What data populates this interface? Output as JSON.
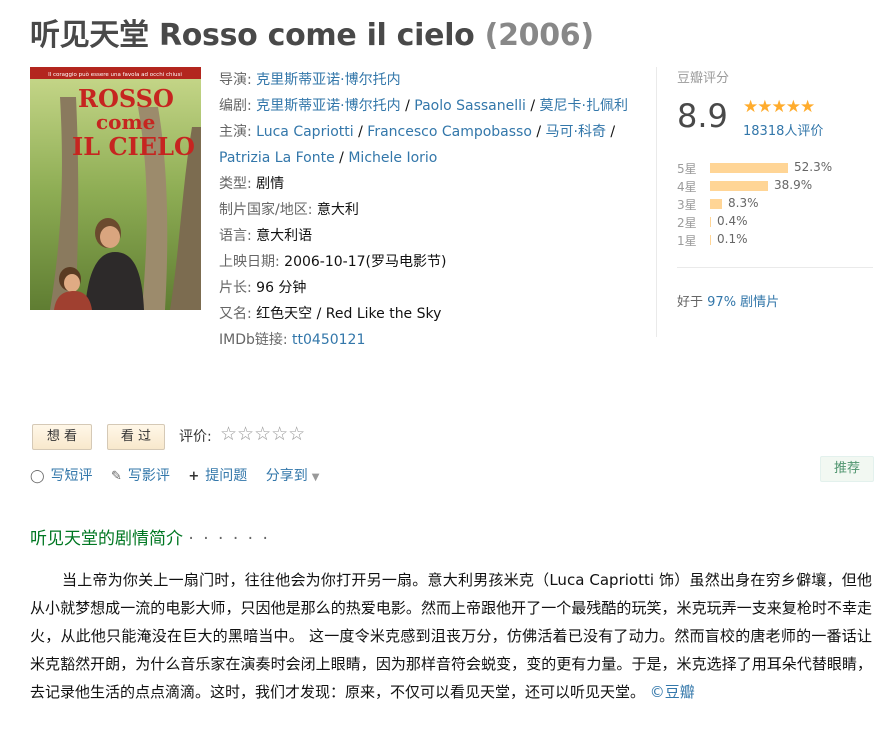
{
  "title": {
    "main": "听见天堂 Rosso come il cielo",
    "year": "(2006)"
  },
  "poster": {
    "tagline": "Il coraggio può essere una favola ad occhi chiusi",
    "title_line1": "ROSSO",
    "title_line2": "come",
    "title_line3": "IL CIELO"
  },
  "info": {
    "director_label": "导演:",
    "director": "克里斯蒂亚诺·博尔托内",
    "writer_label": "编剧:",
    "writers": [
      "克里斯蒂亚诺·博尔托内",
      "Paolo Sassanelli",
      "莫尼卡·扎佩利"
    ],
    "cast_label": "主演:",
    "cast": [
      "Luca Capriotti",
      "Francesco Campobasso",
      "马可·科奇",
      "Patrizia La Fonte",
      "Michele Iorio"
    ],
    "genre_label": "类型:",
    "genre": "剧情",
    "country_label": "制片国家/地区:",
    "country": "意大利",
    "language_label": "语言:",
    "language": "意大利语",
    "release_label": "上映日期:",
    "release": "2006-10-17(罗马电影节)",
    "runtime_label": "片长:",
    "runtime": "96 分钟",
    "aka_label": "又名:",
    "aka": "红色天空 / Red Like the Sky",
    "imdb_label": "IMDb链接:",
    "imdb": "tt0450121"
  },
  "rating": {
    "label": "豆瓣评分",
    "score": "8.9",
    "stars": "★★★★★",
    "votes": "18318人评价",
    "distribution": [
      {
        "label": "5星",
        "percent": 52.3,
        "text": "52.3%"
      },
      {
        "label": "4星",
        "percent": 38.9,
        "text": "38.9%"
      },
      {
        "label": "3星",
        "percent": 8.3,
        "text": "8.3%"
      },
      {
        "label": "2星",
        "percent": 0.4,
        "text": "0.4%"
      },
      {
        "label": "1星",
        "percent": 0.1,
        "text": "0.1%"
      }
    ],
    "better_prefix": "好于",
    "better_value": "97% 剧情片"
  },
  "actions": {
    "want": "想 看",
    "seen": "看 过",
    "rate_label": "评价:",
    "rate_stars": "☆☆☆☆☆",
    "short_review": "写短评",
    "review": "写影评",
    "question": "提问题",
    "share": "分享到",
    "recommend": "推荐"
  },
  "synopsis": {
    "heading": "听见天堂的剧情简介",
    "dots": "· · · · · ·",
    "text": "当上帝为你关上一扇门时，往往他会为你打开另一扇。意大利男孩米克（Luca Capriotti 饰）虽然出身在穷乡僻壤，但他从小就梦想成一流的电影大师，只因他是那么的热爱电影。然而上帝跟他开了一个最残酷的玩笑，米克玩弄一支来复枪时不幸走火，从此他只能淹没在巨大的黑暗当中。 这一度令米克感到沮丧万分，仿佛活着已没有了动力。然而盲校的唐老师的一番话让米克豁然开朗，为什么音乐家在演奏时会闭上眼睛，因为那样音符会蜕变，变的更有力量。于是，米克选择了用耳朵代替眼睛，去记录他生活的点点滴滴。这时，我们才发现：原来，不仅可以看见天堂，还可以听见天堂。",
    "source": "©豆瓣"
  },
  "colors": {
    "link": "#3377aa",
    "green": "#007722",
    "star": "#ffac2d",
    "bar": "#ffd596"
  }
}
